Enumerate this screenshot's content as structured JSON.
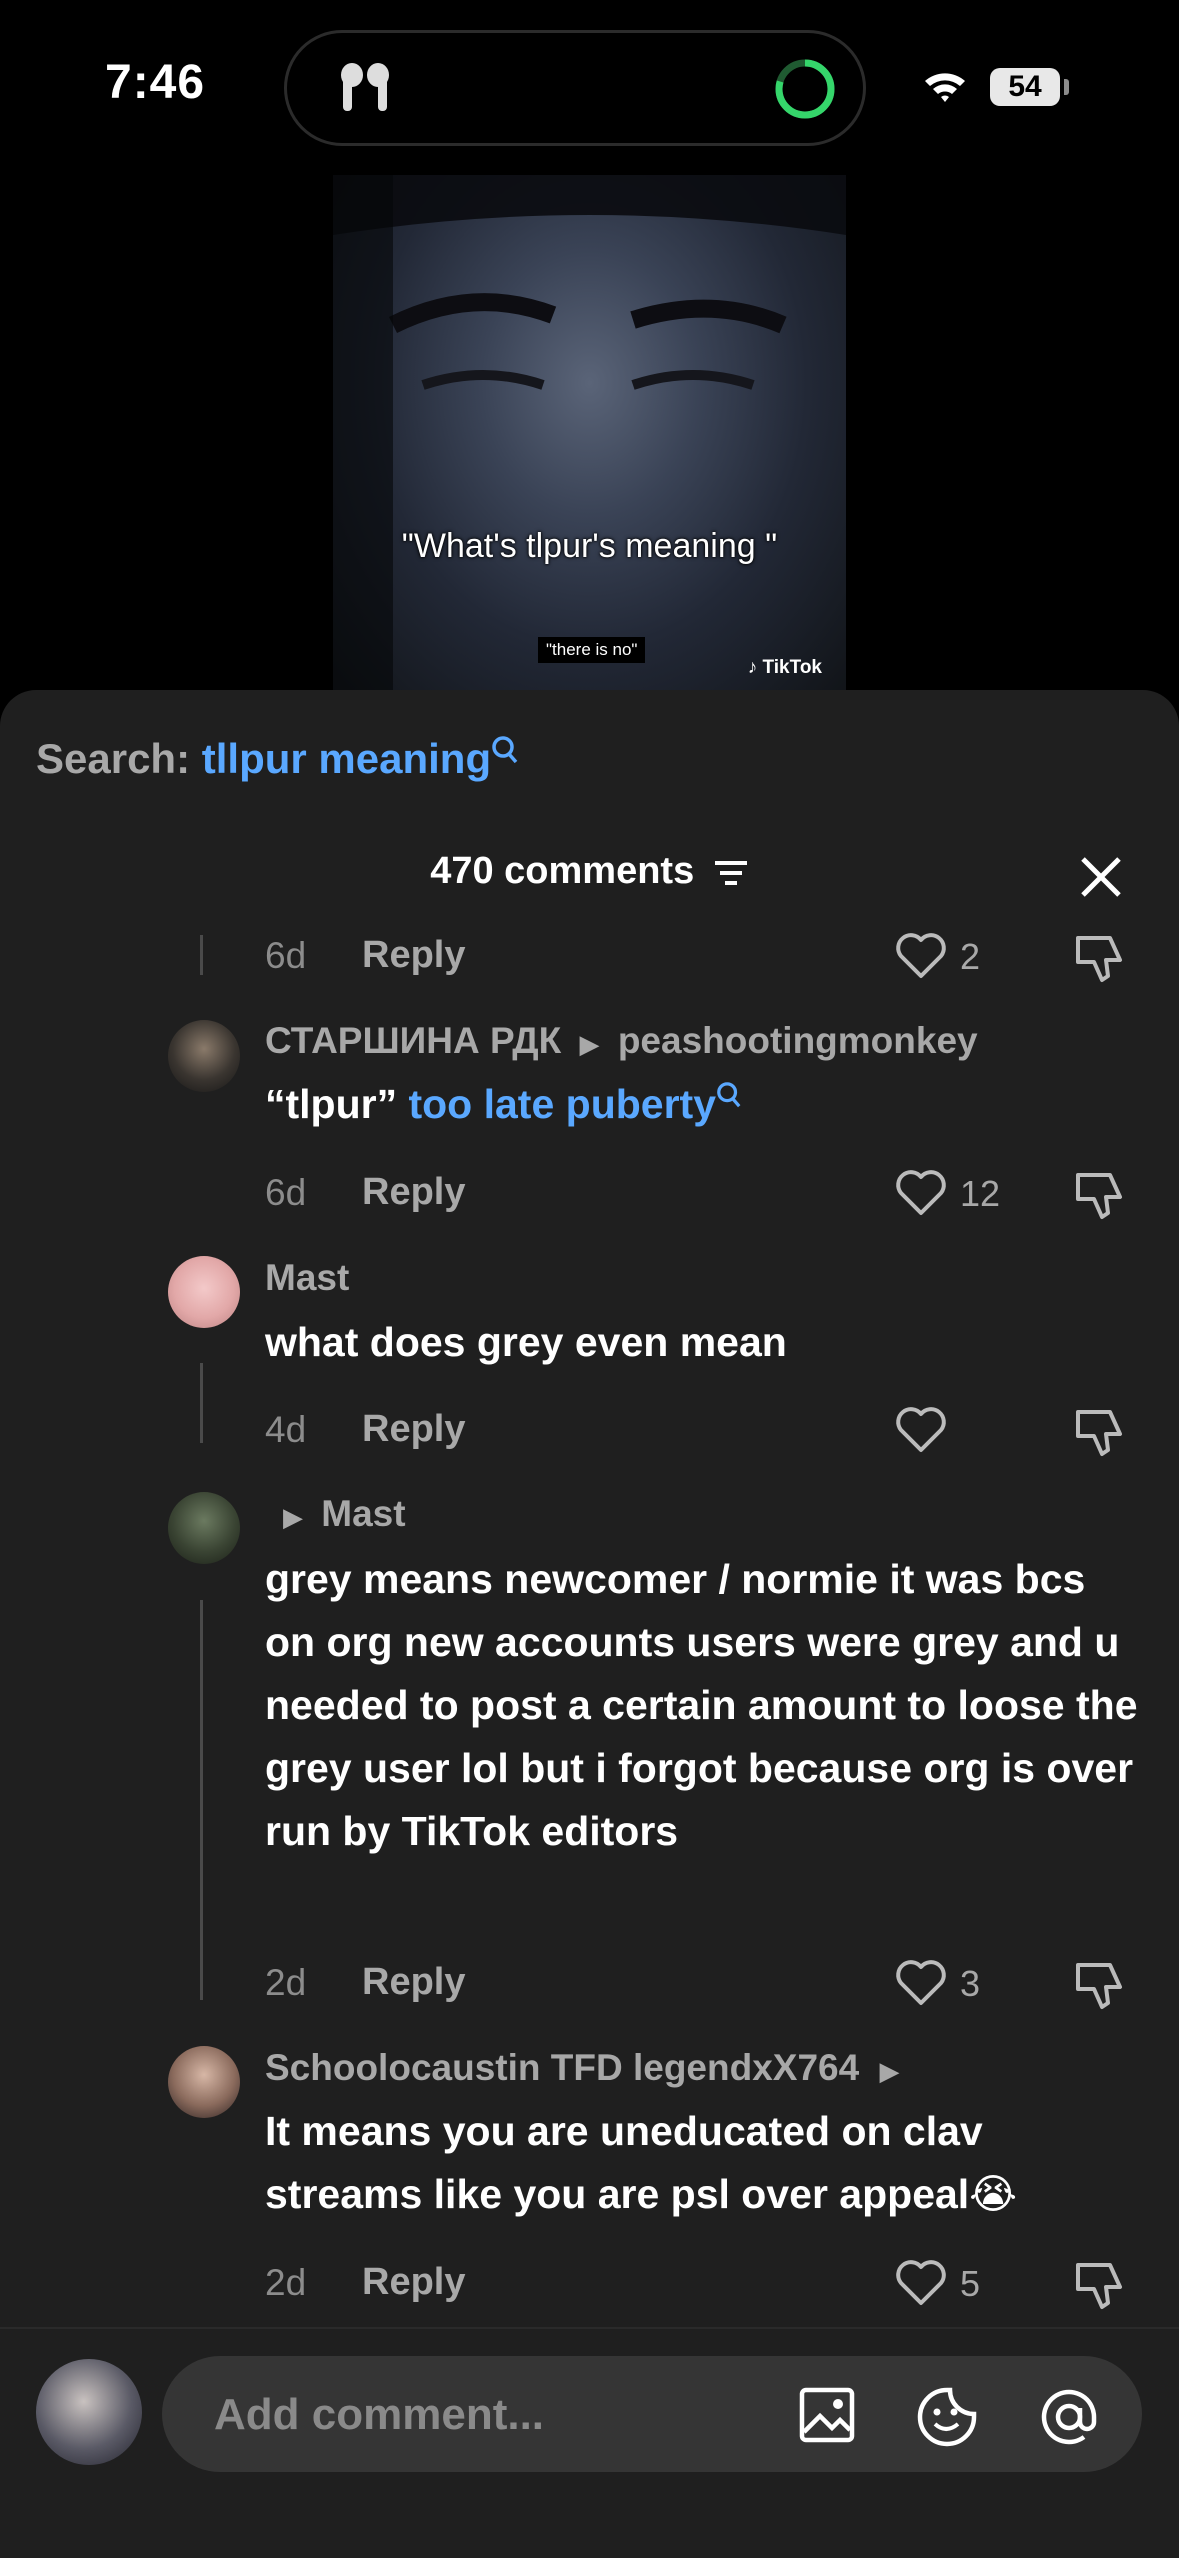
{
  "status_bar": {
    "time": "7:46",
    "battery": "54"
  },
  "video": {
    "caption": "\"What's tlpur's meaning \"",
    "subcaption": "\"there is no\"",
    "watermark": "TikTok"
  },
  "search": {
    "label": "Search:",
    "term": "tllpur meaning"
  },
  "header": {
    "comment_count": "470 comments"
  },
  "comments": [
    {
      "time": "6d",
      "reply": "Reply",
      "likes": "2"
    },
    {
      "user": "СТАРШИНА РДК",
      "reply_to": "peashootingmonkey",
      "text_plain": "“tlpur” ",
      "text_link": "too late puberty",
      "time": "6d",
      "reply": "Reply",
      "likes": "12"
    },
    {
      "user": "Mast",
      "text": "what does grey even mean",
      "time": "4d",
      "reply": "Reply",
      "likes": ""
    },
    {
      "reply_to": "Mast",
      "text": "grey means newcomer / normie it was bcs on org new accounts users were grey and u needed to post a certain amount to loose the grey user lol but i forgot because org is over run by TikTok editors",
      "time": "2d",
      "reply": "Reply",
      "likes": "3"
    },
    {
      "user": "Schoolocaustin TFD legendxX764",
      "text": "It means you are uneducated on clav streams like you are psl over appeal😭",
      "time": "2d",
      "reply": "Reply",
      "likes": "5"
    }
  ],
  "bottom": {
    "placeholder": "Add comment..."
  },
  "colors": {
    "link": "#5aa8ff",
    "sheet_bg": "#1f1f1f",
    "ring": "#35d66b"
  }
}
